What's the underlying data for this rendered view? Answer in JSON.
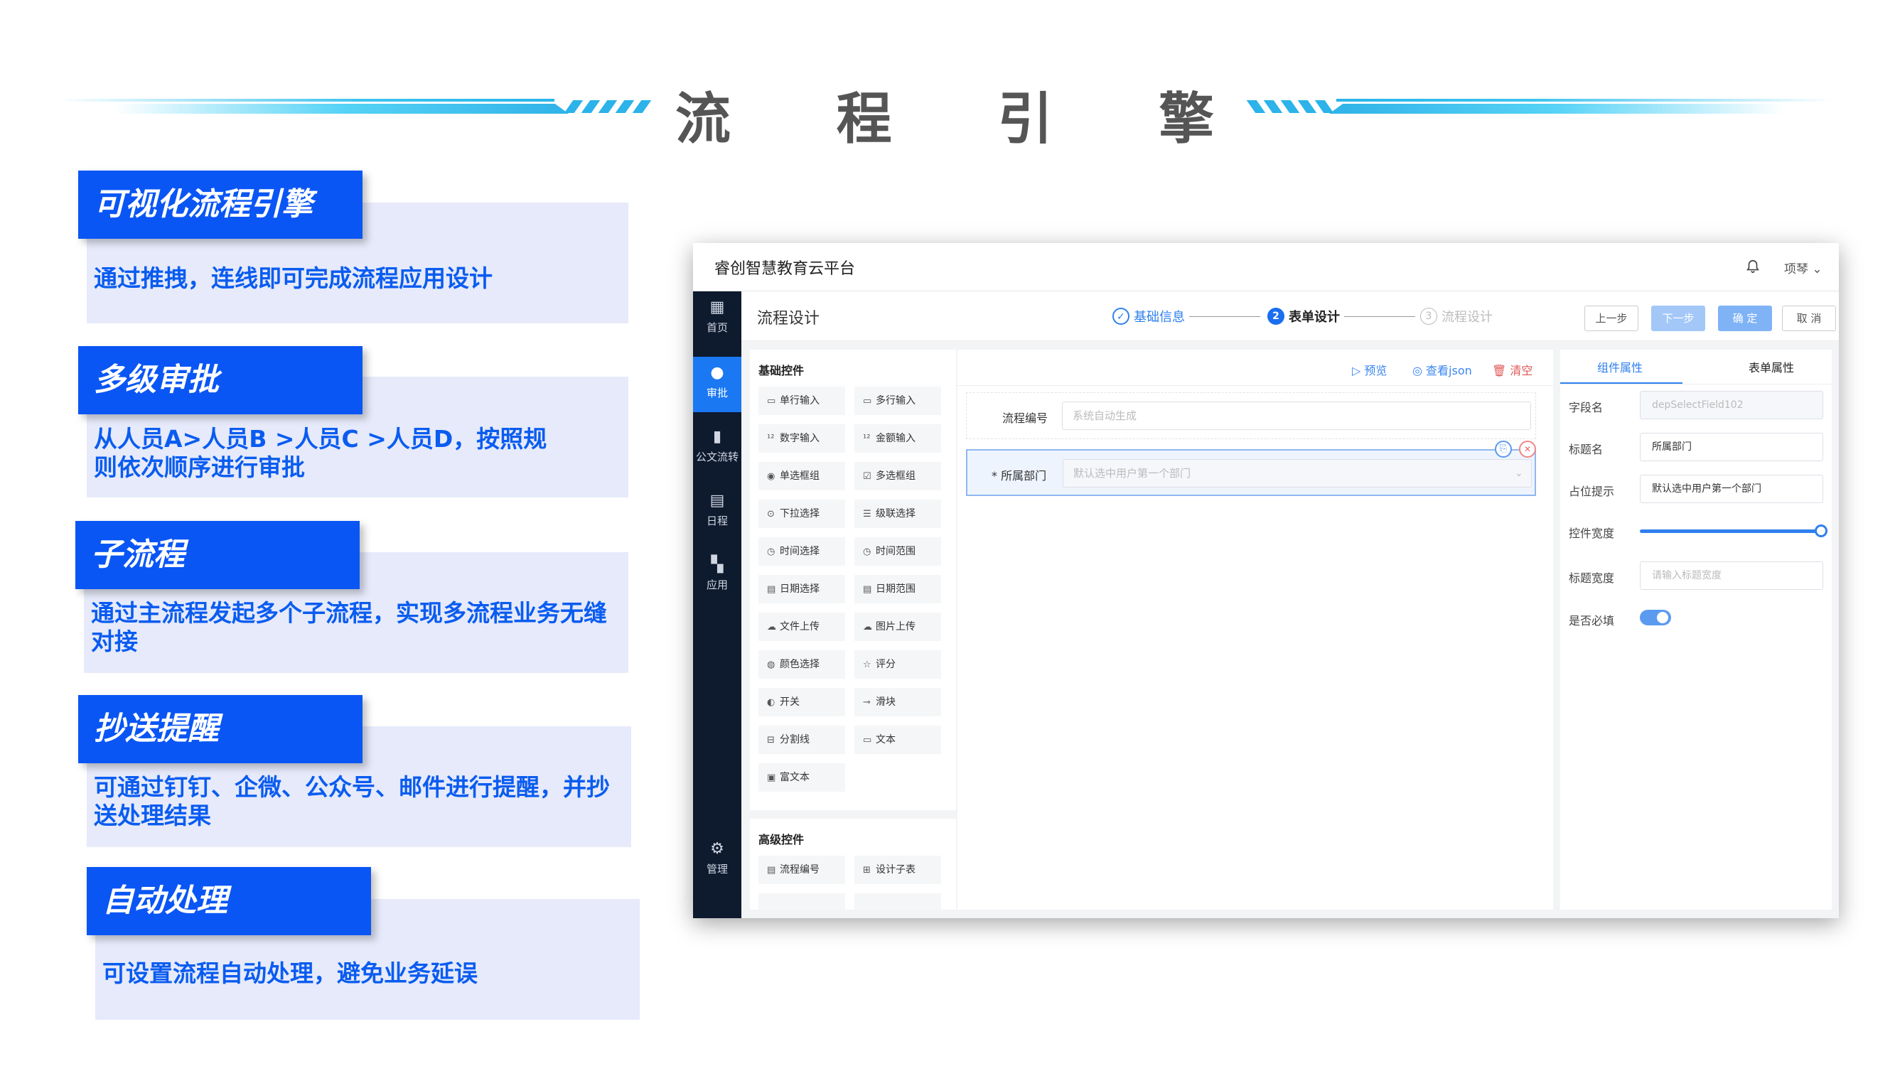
{
  "header": {
    "title_chars": [
      "流",
      "程",
      "引",
      "擎"
    ]
  },
  "features": [
    {
      "title": "可视化流程引擎",
      "desc": "通过推拽，连线即可完成流程应用设计"
    },
    {
      "title": "多级审批",
      "desc": "从人员A>人员B >人员C >人员D，按照规则依次顺序进行审批"
    },
    {
      "title": "子流程",
      "desc": "通过主流程发起多个子流程，实现多流程业务无缝对接"
    },
    {
      "title": "抄送提醒",
      "desc": "可通过钉钉、企微、公众号、邮件进行提醒，并抄送处理结果"
    },
    {
      "title": "自动处理",
      "desc": "可设置流程自动处理，避免业务延误"
    }
  ],
  "app": {
    "title": "睿创智慧教育云平台",
    "user": "项琴 ⌄",
    "nav": [
      {
        "label": "首页",
        "icon": "chart-icon"
      },
      {
        "label": "审批",
        "icon": "user-icon"
      },
      {
        "label": "公文流转",
        "icon": "doc-icon"
      },
      {
        "label": "日程",
        "icon": "calendar-icon"
      },
      {
        "label": "应用",
        "icon": "grid-icon"
      },
      {
        "label": "管理",
        "icon": "gear-icon"
      }
    ],
    "page_title": "流程设计",
    "steps": [
      {
        "label": "基础信息",
        "num": "✓"
      },
      {
        "label": "表单设计",
        "num": "2"
      },
      {
        "label": "流程设计",
        "num": "3"
      }
    ],
    "buttons": {
      "prev": "上一步",
      "next": "下一步",
      "confirm": "确 定",
      "cancel": "取 消"
    },
    "basic_title": "基础控件",
    "basic_items": [
      "单行输入",
      "多行输入",
      "数字输入",
      "金额输入",
      "单选框组",
      "多选框组",
      "下拉选择",
      "级联选择",
      "时间选择",
      "时间范围",
      "日期选择",
      "日期范围",
      "文件上传",
      "图片上传",
      "颜色选择",
      "评分",
      "开关",
      "滑块",
      "分割线",
      "文本",
      "富文本"
    ],
    "advanced_title": "高级控件",
    "advanced_items": [
      "流程编号",
      "设计子表"
    ],
    "tools": {
      "preview": "预览",
      "json": "查看json",
      "clear": "清空"
    },
    "form": [
      {
        "label": "流程编号",
        "placeholder": "系统自动生成"
      },
      {
        "label": "* 所属部门",
        "placeholder": "默认选中用户第一个部门"
      }
    ],
    "prop_tabs": [
      "组件属性",
      "表单属性"
    ],
    "props": [
      {
        "label": "字段名",
        "value": "depSelectField102"
      },
      {
        "label": "标题名",
        "value": "所属部门"
      },
      {
        "label": "占位提示",
        "value": "默认选中用户第一个部门"
      },
      {
        "label": "控件宽度",
        "value": ""
      },
      {
        "label": "标题宽度",
        "value": "请输入标题宽度"
      },
      {
        "label": "是否必填",
        "value": ""
      }
    ]
  }
}
